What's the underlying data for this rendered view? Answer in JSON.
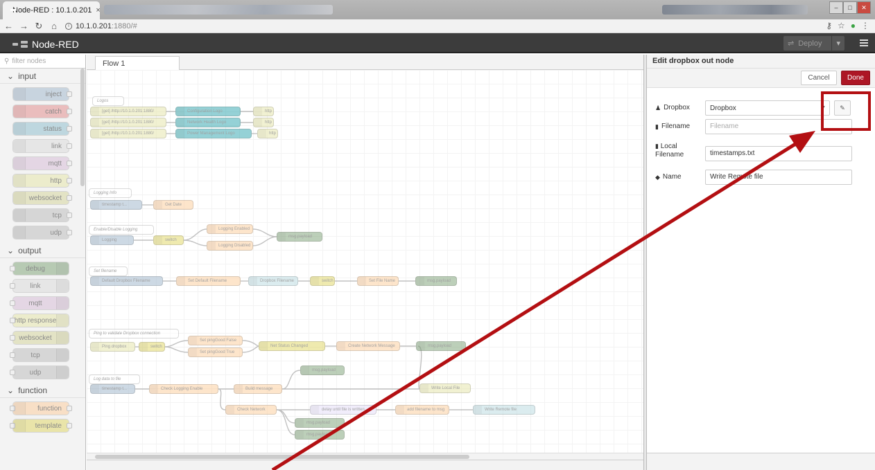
{
  "browser": {
    "tab_title": "Node-RED : 10.1.0.201",
    "tab_close": "×",
    "url_host": "10.1.0.201",
    "url_rest": ":1880/#"
  },
  "header": {
    "app_name": "Node-RED",
    "deploy_label": "Deploy"
  },
  "palette": {
    "search_placeholder": "filter nodes",
    "categories": [
      {
        "label": "input",
        "nodes": [
          "inject",
          "catch",
          "status",
          "link",
          "mqtt",
          "http",
          "websocket",
          "tcp",
          "udp"
        ]
      },
      {
        "label": "output",
        "nodes": [
          "debug",
          "link",
          "mqtt",
          "http response",
          "websocket",
          "tcp",
          "udp"
        ]
      },
      {
        "label": "function",
        "nodes": [
          "function",
          "template"
        ]
      }
    ]
  },
  "workspace": {
    "tab_label": "Flow 1",
    "comments": [
      "Logos",
      "Logging Info",
      "Enable/Disable Logging",
      "Set filename",
      "Ping to validate Dropbox connection",
      "Log data to file"
    ],
    "nodes": {
      "get1": "[get] /http://10.1.0.201:1880/",
      "get2": "[get] /http://10.1.0.201:1880/",
      "get3": "[get] /http://10.1.0.201:1880/",
      "logo1": "Configuration Logo",
      "logo2": "Network Health Logo",
      "logo3": "Power Management Logo",
      "http1": "http",
      "http2": "http",
      "http3": "http",
      "timestamp1": "timestamp t...",
      "getdate": "Get Date",
      "logging": "Logging",
      "switch1": "switch",
      "logen": "Logging Enabled",
      "logdis": "Logging Disabled",
      "msgpayload1": "msg.payload",
      "defaultfn": "Default Dropbox Filename",
      "setdefault": "Set Default Filename",
      "dropboxfn": "Dropbox Filename",
      "switch2": "switch",
      "setfilename": "Set File Name",
      "msgpayload2": "msg.payload",
      "ping": "Ping dropbox",
      "switch3": "switch",
      "pingfalse": "Set pingGood False",
      "pingtrue": "Set pingGood True",
      "netstatus": "Net Status Changed",
      "createnet": "Create Network Message",
      "msgpayload3": "msg.payload",
      "timestamp2": "timestamp t...",
      "checklog": "Check Logging Enable",
      "buildmsg": "Build message",
      "msgpayload4": "msg.payload",
      "writelocal": "Write Local File",
      "checknet": "Check Network",
      "delay": "delay until file is written",
      "addfile": "add filename to msg",
      "writeremote": "Write Remote file",
      "msgpayload5": "msg.payload",
      "msgpayload6": "msg.payload"
    }
  },
  "tray": {
    "title": "Edit dropbox out node",
    "cancel_label": "Cancel",
    "done_label": "Done",
    "dropbox_label": "Dropbox",
    "dropbox_value": "Dropbox",
    "filename_label": "Filename",
    "filename_placeholder": "Filename",
    "local_label_1": "Local",
    "local_label_2": "Filename",
    "local_value": "timestamps.txt",
    "name_label": "Name",
    "name_value": "Write Remote file"
  },
  "colors": {
    "header_bg": "#3c3c3c",
    "done_red": "#ad1625",
    "annotation_red": "#b30f12"
  }
}
